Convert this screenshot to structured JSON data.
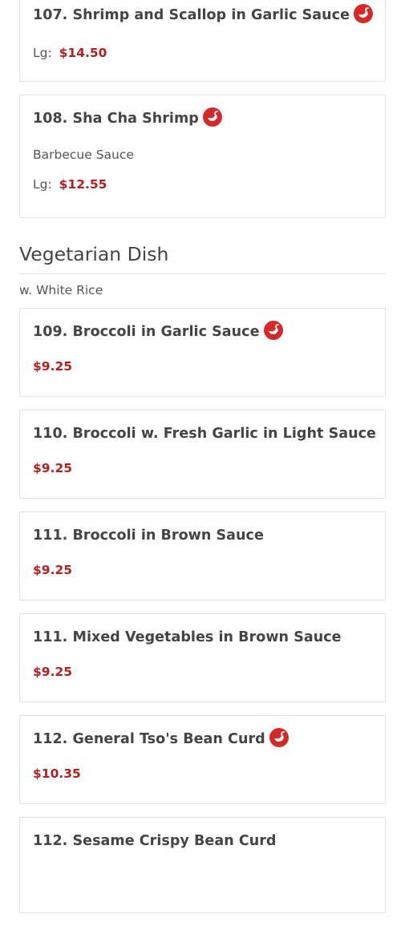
{
  "items_top": [
    {
      "title": "107. Shrimp and Scallop in Garlic Sauce",
      "spicy": true,
      "description": "",
      "size_label": "Lg:",
      "price": "$14.50"
    },
    {
      "title": "108. Sha Cha Shrimp",
      "spicy": true,
      "description": "Barbecue Sauce",
      "size_label": "Lg:",
      "price": "$12.55"
    }
  ],
  "section": {
    "title": "Vegetarian Dish",
    "subtitle": "w. White Rice"
  },
  "items_veg": [
    {
      "title": "109. Broccoli in Garlic Sauce",
      "spicy": true,
      "price": "$9.25"
    },
    {
      "title": "110. Broccoli w. Fresh Garlic in Light Sauce",
      "spicy": false,
      "price": "$9.25"
    },
    {
      "title": "111. Broccoli in Brown Sauce",
      "spicy": false,
      "price": "$9.25"
    },
    {
      "title": "111. Mixed Vegetables in Brown Sauce",
      "spicy": false,
      "price": "$9.25"
    },
    {
      "title": "112. General Tso's Bean Curd",
      "spicy": true,
      "price": "$10.35"
    },
    {
      "title": "112. Sesame Crispy Bean Curd",
      "spicy": false,
      "price": ""
    }
  ],
  "colors": {
    "price": "#b81e1e",
    "spicy_icon": "#d62828",
    "text": "#444444",
    "border": "#e2e2e2"
  },
  "icons": {
    "spicy": "chili-pepper-icon"
  }
}
